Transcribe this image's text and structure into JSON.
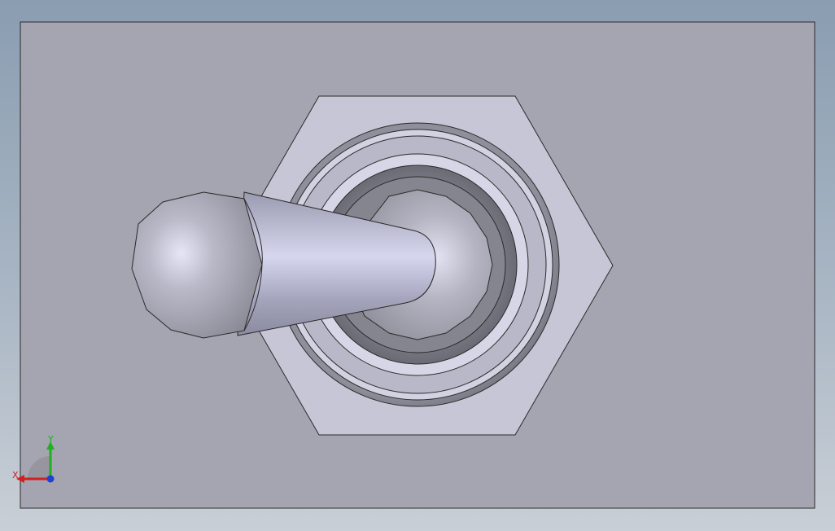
{
  "viewport": {
    "background_top": "#8a9db1",
    "background_bottom": "#c9cfd6",
    "plate_color": "#a5a4b1"
  },
  "model": {
    "part": "toggle-switch",
    "view": "front"
  },
  "triad": {
    "x_label": "X",
    "y_label": "Y",
    "x_color": "#d02020",
    "y_color": "#20b020",
    "z_color": "#2040d0"
  }
}
